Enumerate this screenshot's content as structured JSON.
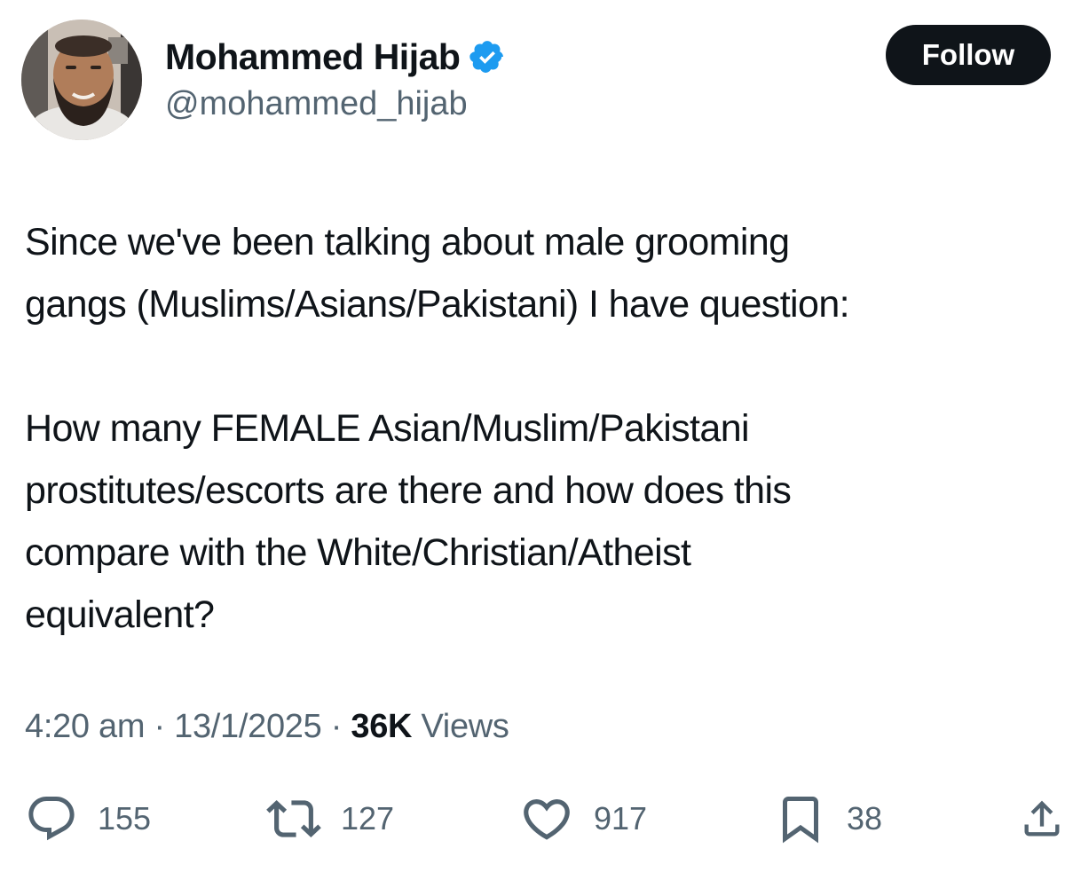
{
  "author": {
    "name": "Mohammed Hijab",
    "handle": "@mohammed_hijab"
  },
  "follow_label": "Follow",
  "tweet": {
    "paragraph1": [
      "Since we've been talking about male grooming",
      "gangs (Muslims/Asians/Pakistani) I have question:"
    ],
    "paragraph2": [
      "How many FEMALE Asian/Muslim/Pakistani",
      "prostitutes/escorts are there and how does this",
      "compare with the White/Christian/Atheist",
      "equivalent?"
    ]
  },
  "meta": {
    "time": "4:20 am",
    "separator": "·",
    "date": "13/1/2025",
    "views_count": "36K",
    "views_label": "Views"
  },
  "actions": {
    "reply": {
      "icon": "reply-bubble-icon",
      "count": "155"
    },
    "retweet": {
      "icon": "retweet-icon",
      "count": "127"
    },
    "like": {
      "icon": "heart-icon",
      "count": "917"
    },
    "bookmark": {
      "icon": "bookmark-icon",
      "count": "38"
    },
    "share": {
      "icon": "share-icon"
    }
  },
  "colors": {
    "text": "#0f1419",
    "secondary": "#536471",
    "verified": "#1d9bf0",
    "follow_bg": "#0f1419"
  }
}
